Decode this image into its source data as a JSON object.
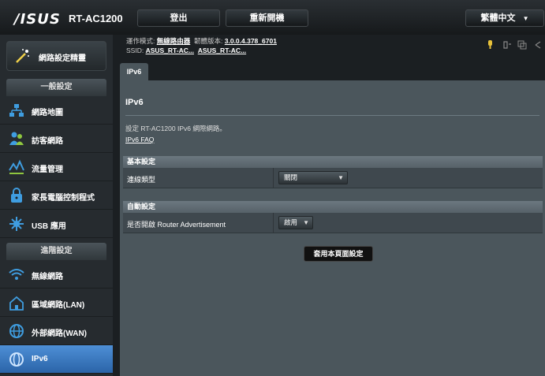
{
  "header": {
    "brand": "/ISUS",
    "model": "RT-AC1200",
    "logout_label": "登出",
    "reboot_label": "重新開機",
    "language_label": "繁體中文"
  },
  "info": {
    "mode_label": "運作模式:",
    "mode_value": "無線路由器",
    "fw_label": "韌體版本:",
    "fw_value": "3.0.0.4.378_6701",
    "ssid_label": "SSID:",
    "ssid_1": "ASUS_RT-AC...",
    "ssid_2": "ASUS_RT-AC..."
  },
  "sidebar": {
    "quick_setup": "網路設定精靈",
    "general_header": "一般設定",
    "general_items": [
      {
        "label": "網路地圖",
        "icon": "network-map-icon"
      },
      {
        "label": "訪客網路",
        "icon": "guest-network-icon"
      },
      {
        "label": "流量管理",
        "icon": "traffic-manager-icon"
      },
      {
        "label": "家長電腦控制程式",
        "icon": "parental-control-icon"
      },
      {
        "label": "USB 應用",
        "icon": "usb-icon"
      }
    ],
    "advanced_header": "進階設定",
    "advanced_items": [
      {
        "label": "無線網路",
        "icon": "wireless-icon"
      },
      {
        "label": "區域網路(LAN)",
        "icon": "lan-icon"
      },
      {
        "label": "外部網路(WAN)",
        "icon": "wan-icon"
      },
      {
        "label": "IPv6",
        "icon": "ipv6-icon"
      }
    ]
  },
  "tab": {
    "label": "IPv6"
  },
  "main": {
    "title": "IPv6",
    "description": "設定 RT-AC1200 IPv6 網際網路。",
    "faq_link": "IPv6 FAQ",
    "basic_header": "基本設定",
    "conn_type_label": "連線類型",
    "conn_type_value": "關閉",
    "auto_header": "自動設定",
    "ra_label": "是否開啟 Router Advertisement",
    "ra_value": "啟用",
    "apply_label": "套用本頁面設定"
  },
  "colors": {
    "accent": "#2b64a8",
    "panel": "#4b565c"
  }
}
